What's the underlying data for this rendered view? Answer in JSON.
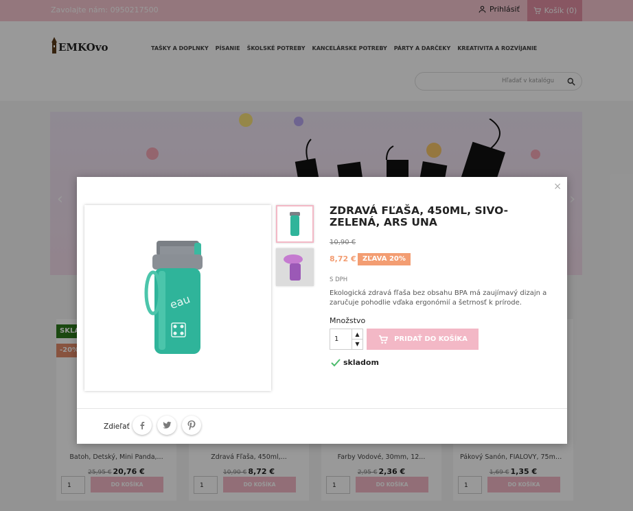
{
  "topbar": {
    "contact": "Zavolajte nám: 0950217500",
    "login": "Prihlásiť",
    "cart": "Košík (0)"
  },
  "logo": {
    "text": "EMKOvo"
  },
  "nav": [
    "TAŠKY A DOPLNKY",
    "PÍSANIE",
    "ŠKOLSKÉ POTREBY",
    "KANCELÁRSKE POTREBY",
    "PÁRTY A DARČEKY",
    "KREATIVITA A ROZVÍJANIE"
  ],
  "search": {
    "placeholder": "Hľadať v katalógu"
  },
  "badges": {
    "new": "SKLA",
    "discount": "-20%"
  },
  "products": [
    {
      "name": "Batoh, Detský, Mini Panda,...",
      "old": "25,95 €",
      "price": "20,76 €",
      "qty": "1",
      "add": "DO KOŠÍKA"
    },
    {
      "name": "Zdravá Fľaša, 450ml,...",
      "old": "10,90 €",
      "price": "8,72 €",
      "qty": "1",
      "add": "DO KOŠÍKA"
    },
    {
      "name": "Farby Vodové, 30mm, 12...",
      "old": "2,95 €",
      "price": "2,36 €",
      "qty": "1",
      "add": "DO KOŠÍKA"
    },
    {
      "name": "Pákový Šanón, FIALOVÝ, 75mm...",
      "old": "1,69 €",
      "price": "1,35 €",
      "qty": "1",
      "add": "DO KOŠÍKA"
    }
  ],
  "modal": {
    "title": "ZDRAVÁ FĽAŠA, 450ML, SIVO-ZELENÁ, ARS UNA",
    "old_price": "10,90 €",
    "price": "8,72 €",
    "discount": "ZĽAVA 20%",
    "tax": "S DPH",
    "description": "Ekologická zdravá fľaša bez obsahu BPA má zaujímavý dizajn a zaručuje pohodlie vďaka ergonómií a šetrnosť k prírode.",
    "qty_label": "Množstvo",
    "qty": "1",
    "add_to_cart": "PRIDAŤ DO KOŠÍKA",
    "stock": "skladom",
    "share_label": "Zdieľať",
    "close": "×",
    "bottle_text": "eau"
  },
  "colors": {
    "accent": "#f3b8c6",
    "discount": "#f39d72",
    "topbar": "#f7c6d0"
  }
}
